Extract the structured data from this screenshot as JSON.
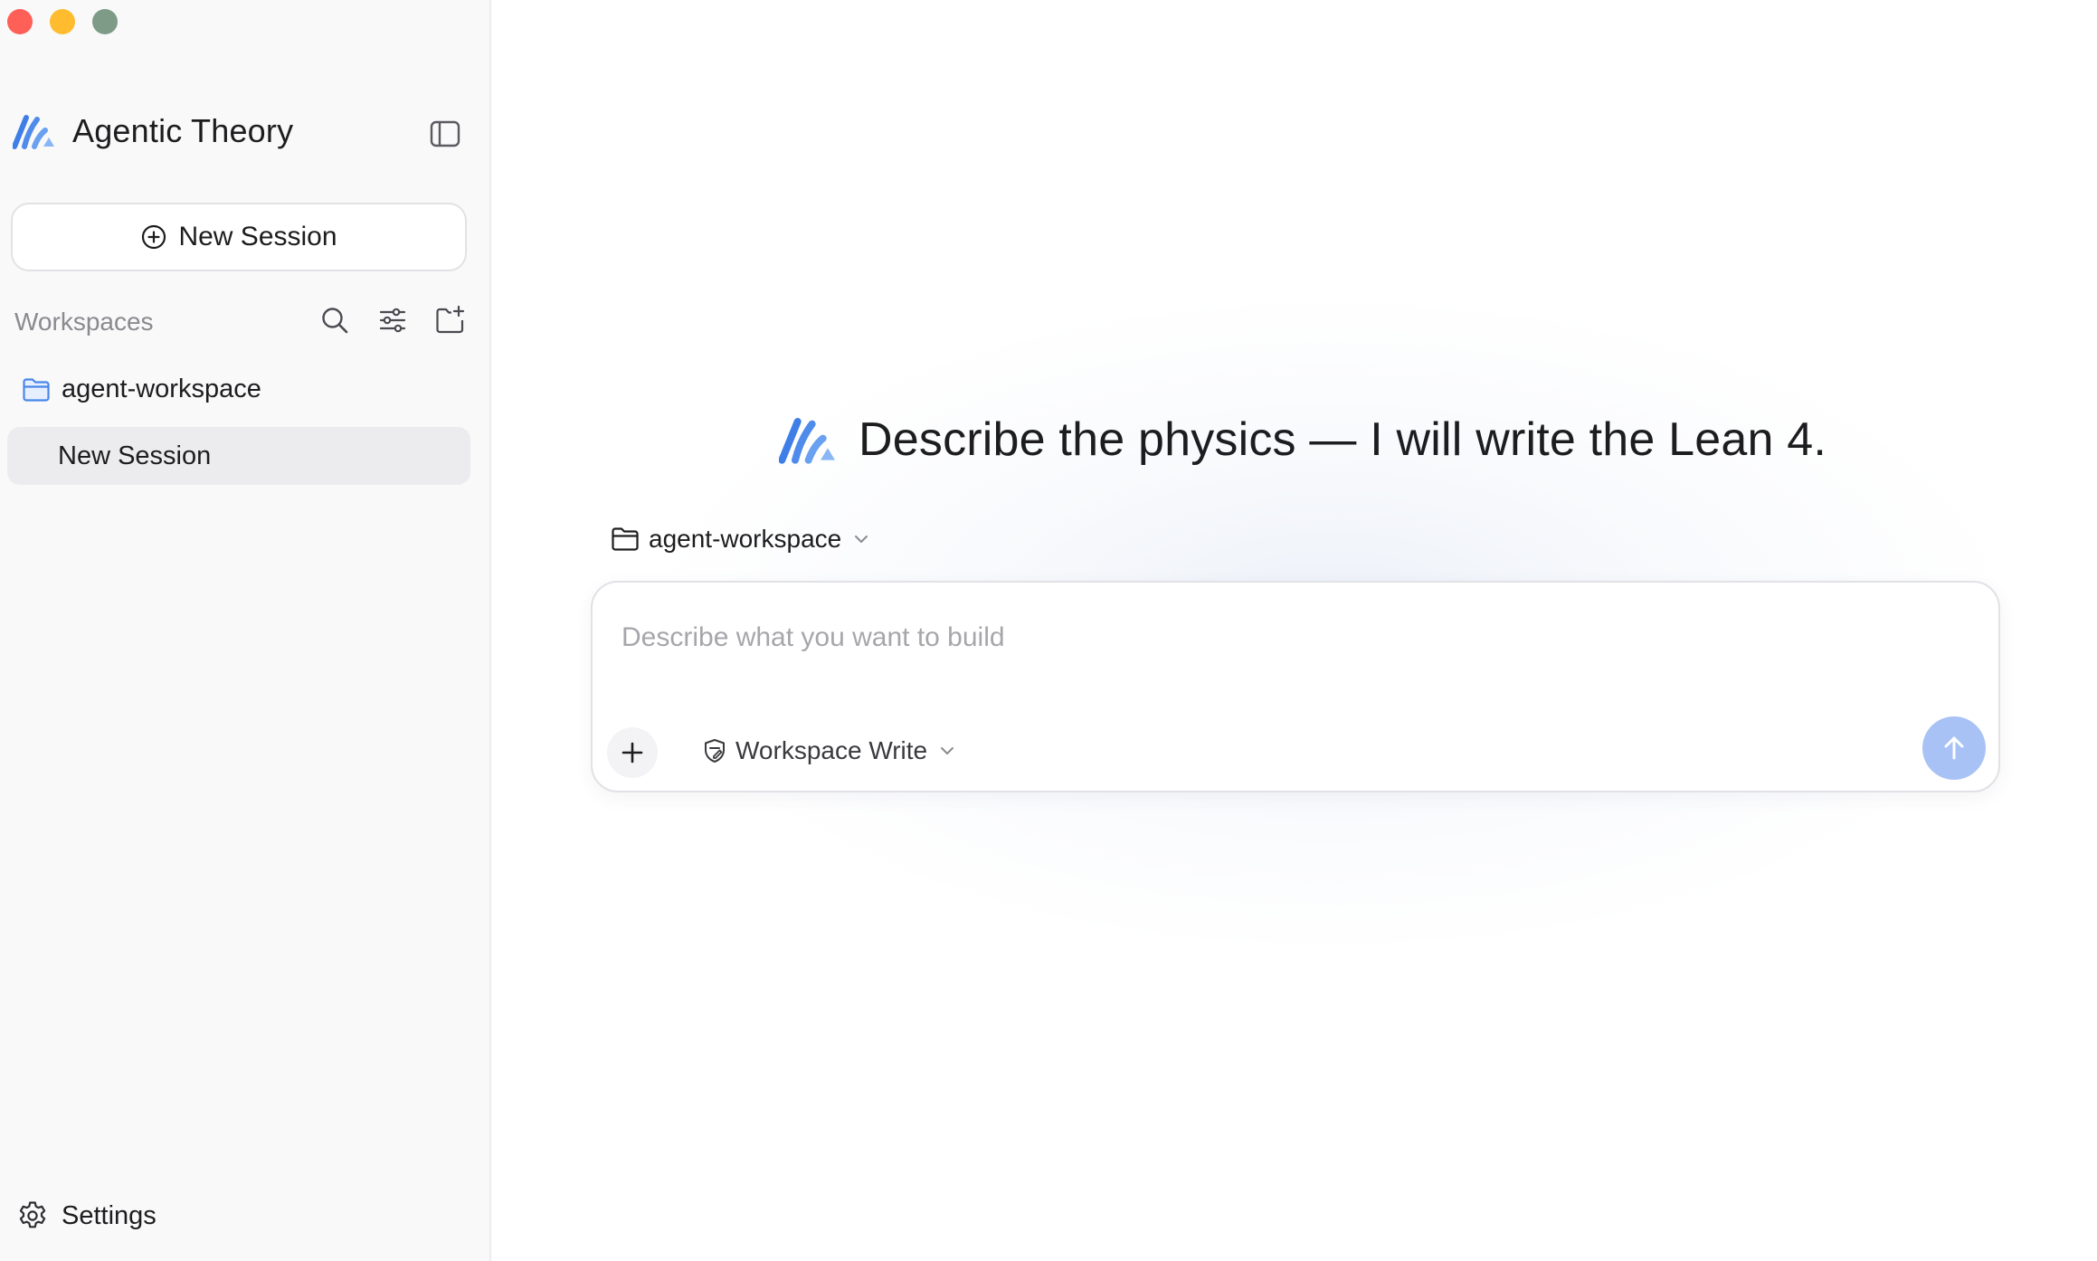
{
  "window": {
    "controls": [
      "close",
      "minimize",
      "maximize"
    ]
  },
  "sidebar": {
    "brand": {
      "title": "Agentic Theory",
      "logo_icon": "brand-logo-icon"
    },
    "toggle_icon": "sidebar-toggle-icon",
    "new_session_label": "New Session",
    "workspaces": {
      "title": "Workspaces",
      "tools": [
        "search-icon",
        "filter-icon",
        "new-folder-icon"
      ],
      "items": [
        {
          "label": "agent-workspace",
          "icon": "folder-icon",
          "sessions": [
            {
              "label": "New Session",
              "selected": true
            }
          ]
        }
      ]
    },
    "settings_label": "Settings"
  },
  "main": {
    "hero_title": "Describe the physics — I will write the Lean 4.",
    "workspace_selector": {
      "value": "agent-workspace"
    },
    "composer": {
      "placeholder": "Describe what you want to build",
      "value": "",
      "permission": {
        "value": "Workspace Write",
        "icon": "shield-icon"
      },
      "send_disabled": true
    }
  },
  "colors": {
    "accent": "#4a86e8",
    "send_button_disabled": "#a9c2f6",
    "sidebar_bg": "#f9f9fa",
    "selected_item_bg": "#ececee",
    "traffic_close": "#fe5f57",
    "traffic_minimize": "#febc2e",
    "traffic_maximize": "#7d9b86"
  }
}
